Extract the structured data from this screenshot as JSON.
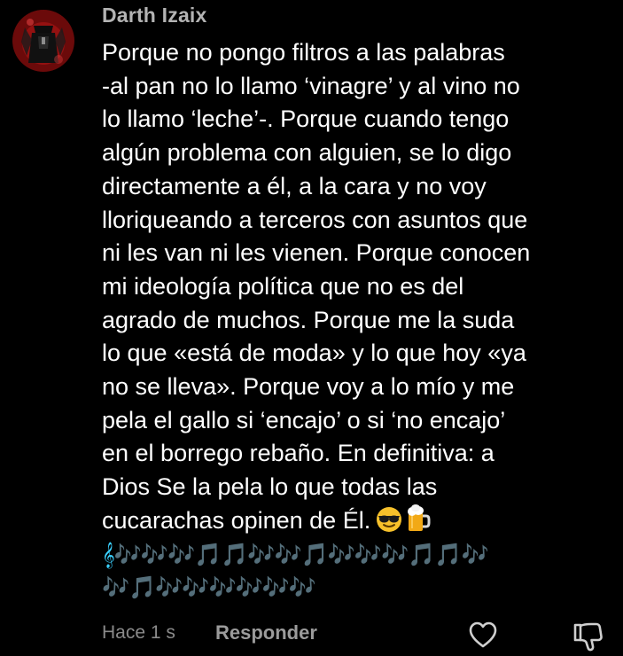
{
  "comment": {
    "author": "Darth Izaix",
    "lines": [
      "Porque no pongo filtros a las palabras",
      "-al pan no lo llamo ‘vinagre’ y al vino no",
      "lo llamo ‘leche’-. Porque cuando tengo",
      "algún problema con alguien, se lo digo",
      "directamente a él, a la cara y no voy",
      "lloriqueando a terceros con asuntos que",
      "ni les van ni les vienen. Porque conocen",
      "mi ideología política que no es del",
      "agrado de muchos. Porque me la suda",
      "lo que «está de moda» y lo que hoy «ya",
      "no se lleva». Porque voy a lo mío y me",
      "pela el gallo si ‘encajo’ o si ‘no encajo’",
      "en el borrego rebaño. En definitiva: a",
      "Dios Se la pela lo que todas las",
      "cucarachas opinen de Él."
    ],
    "emojis": [
      "smiling-face-with-sunglasses",
      "beer-mug"
    ],
    "music_lines": [
      "𝄞🎶🎶🎶🎵🎵🎶🎶🎵🎶🎶🎶🎵🎵🎶",
      "🎶🎵🎶🎶🎶🎶🎶🎶"
    ]
  },
  "footer": {
    "time": "Hace 1 s",
    "reply_label": "Responder",
    "like_icon": "heart-outline-icon",
    "dislike_icon": "thumbs-down-outline-icon"
  },
  "colors": {
    "background": "#000000",
    "author": "#b3b3b3",
    "text": "#ffffff",
    "muted": "#8a8a8a",
    "music": "#3ad1ff"
  }
}
